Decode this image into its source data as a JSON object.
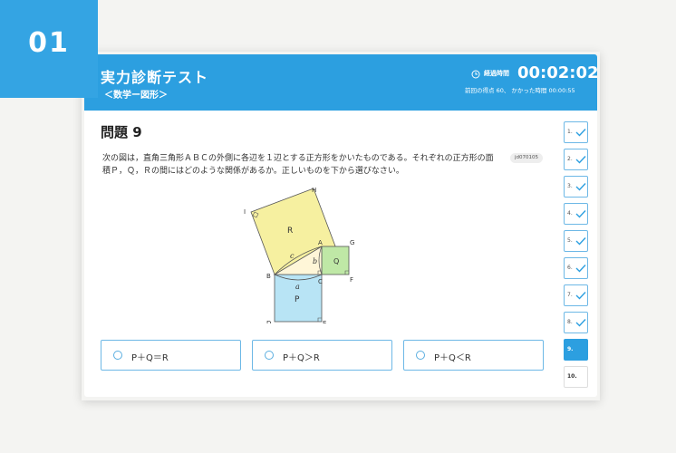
{
  "badge": {
    "number": "01"
  },
  "header": {
    "title": "実力診断テスト",
    "subtitle": "＜数学ー図形＞",
    "timer_label": "経過時間",
    "timer": "00:02:02",
    "timer_sub": "前回の得点 60、 かかった時間 00:00:55"
  },
  "question": {
    "title": "問題 9",
    "text": "次の図は，直角三角形ＡＢＣの外側に各辺を１辺とする正方形をかいたものである。それぞれの正方形の面積Ｐ，Ｑ，Ｒの間にはどのような関係があるか。正しいものを下から選びなさい。",
    "id": "jd070105"
  },
  "figure": {
    "points": {
      "A": "A",
      "B": "B",
      "C": "C",
      "D": "D",
      "E": "E",
      "F": "F",
      "G": "G",
      "H": "H",
      "I": "I"
    },
    "areas": {
      "P": "P",
      "Q": "Q",
      "R": "R"
    },
    "sides": {
      "a": "a",
      "b": "b",
      "c": "c"
    }
  },
  "answers": [
    {
      "label": "P＋Q＝R"
    },
    {
      "label": "P＋Q＞R"
    },
    {
      "label": "P＋Q＜R"
    }
  ],
  "nav": [
    {
      "label": "1.",
      "done": true
    },
    {
      "label": "2.",
      "done": true
    },
    {
      "label": "3.",
      "done": true
    },
    {
      "label": "4.",
      "done": true
    },
    {
      "label": "5.",
      "done": true
    },
    {
      "label": "6.",
      "done": true
    },
    {
      "label": "7.",
      "done": true
    },
    {
      "label": "8.",
      "done": true
    },
    {
      "label": "9.",
      "active": true
    },
    {
      "label": "10."
    }
  ],
  "colors": {
    "primary": "#2c9fe0",
    "badge": "#34a4e3",
    "square_p": "#b8e4f5",
    "square_q": "#bfe8a6",
    "square_r": "#f6f0a0"
  }
}
